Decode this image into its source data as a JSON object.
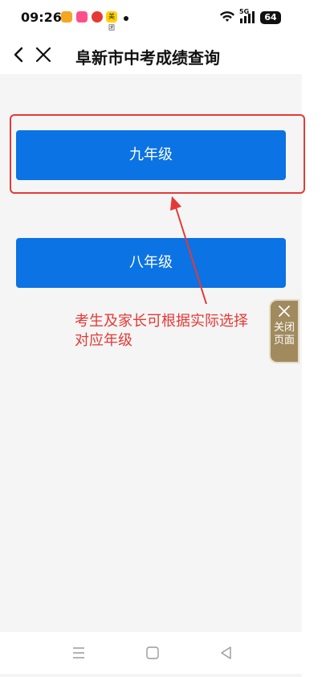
{
  "status_bar": {
    "time": "09:26",
    "network_label": "5G",
    "battery_level": "64",
    "app_icons": [
      {
        "name": "weibo-icon",
        "color": "#f5a623"
      },
      {
        "name": "shopping-app-icon",
        "color": "#ff4f8b"
      },
      {
        "name": "map-pin-app-icon",
        "color": "#e53935"
      },
      {
        "name": "meituan-app-icon",
        "color": "#ffd100",
        "label": "美团"
      }
    ]
  },
  "nav": {
    "title": "阜新市中考成绩查询"
  },
  "grades": {
    "grade9_label": "九年级",
    "grade8_label": "八年级"
  },
  "annotation": {
    "text": "考生及家长可根据实际选择对应年级"
  },
  "float_close": {
    "label": "关闭页面"
  },
  "colors": {
    "primary": "#0b73e3",
    "annotation_red": "#e53935",
    "float_brown": "#a08a5e"
  }
}
